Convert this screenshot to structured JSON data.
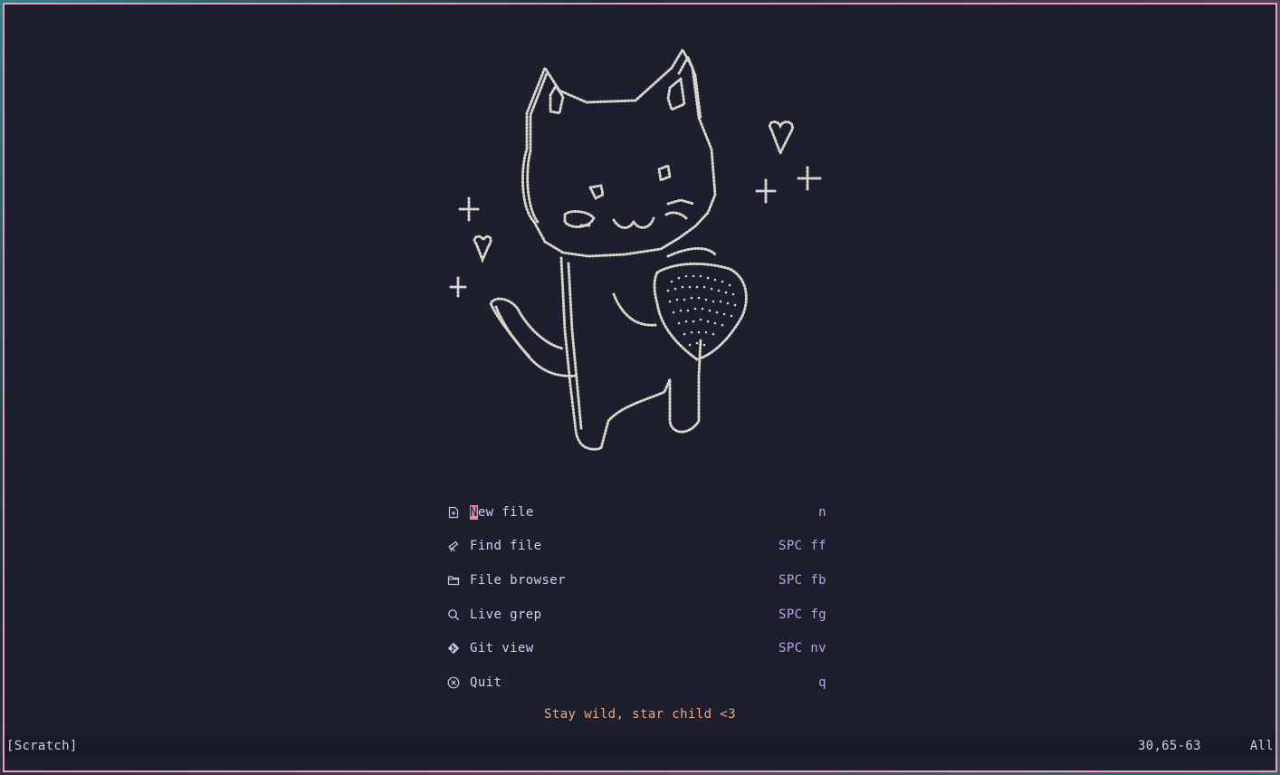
{
  "menu": {
    "items": [
      {
        "icon": "new-file-icon",
        "label": "New file",
        "key": "n"
      },
      {
        "icon": "telescope-icon",
        "label": "Find file",
        "key": "SPC ff"
      },
      {
        "icon": "folder-icon",
        "label": "File browser",
        "key": "SPC fb"
      },
      {
        "icon": "search-icon",
        "label": "Live grep",
        "key": "SPC fg"
      },
      {
        "icon": "git-icon",
        "label": "Git view",
        "key": "SPC nv"
      },
      {
        "icon": "quit-icon",
        "label": "Quit",
        "key": "q"
      }
    ],
    "cursor_item": 0
  },
  "tagline": "Stay wild, star child <3",
  "statusline": {
    "buffer": "[Scratch]",
    "position": "30,65-63",
    "scroll": "All"
  },
  "colors": {
    "background": "#1e1f2e",
    "border": "#e6a0bd",
    "text": "#cdd3e6",
    "key": "#b9a4e6",
    "tagline": "#f0a877",
    "cursor": "#e88aa8",
    "art": "#d8d6c8"
  }
}
